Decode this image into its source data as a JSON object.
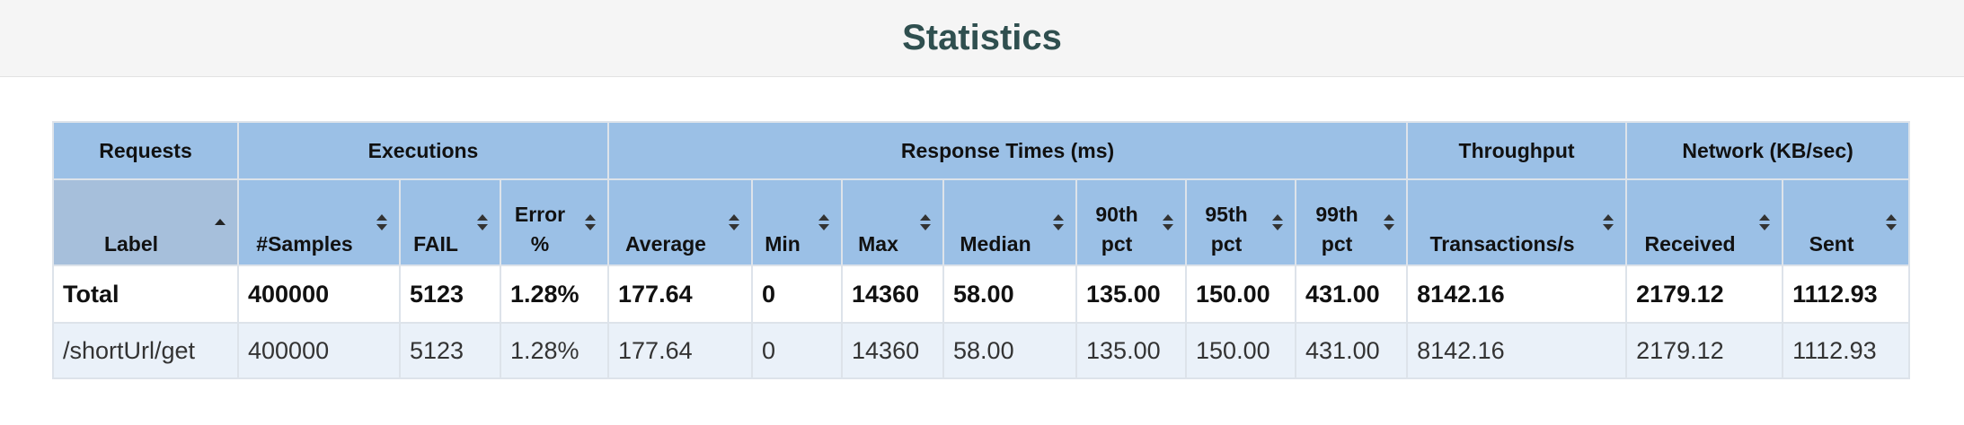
{
  "page": {
    "title": "Statistics"
  },
  "groups": {
    "requests": "Requests",
    "executions": "Executions",
    "response_times": "Response Times (ms)",
    "throughput": "Throughput",
    "network": "Network (KB/sec)"
  },
  "columns": {
    "label": "Label",
    "samples": "#Samples",
    "fail": "FAIL",
    "error_pct": "Error %",
    "average": "Average",
    "min": "Min",
    "max": "Max",
    "median": "Median",
    "pct90": "90th pct",
    "pct95": "95th pct",
    "pct99": "99th pct",
    "transactions": "Transactions/s",
    "received": "Received",
    "sent": "Sent"
  },
  "total_row": {
    "label": "Total",
    "samples": "400000",
    "fail": "5123",
    "error_pct": "1.28%",
    "average": "177.64",
    "min": "0",
    "max": "14360",
    "median": "58.00",
    "pct90": "135.00",
    "pct95": "150.00",
    "pct99": "431.00",
    "transactions": "8142.16",
    "received": "2179.12",
    "sent": "1112.93"
  },
  "rows": [
    {
      "label": "/shortUrl/get",
      "samples": "400000",
      "fail": "5123",
      "error_pct": "1.28%",
      "average": "177.64",
      "min": "0",
      "max": "14360",
      "median": "58.00",
      "pct90": "135.00",
      "pct95": "150.00",
      "pct99": "431.00",
      "transactions": "8142.16",
      "received": "2179.12",
      "sent": "1112.93"
    }
  ],
  "sort": {
    "column": "label",
    "direction": "ascending",
    "icon": "sort-icon"
  }
}
